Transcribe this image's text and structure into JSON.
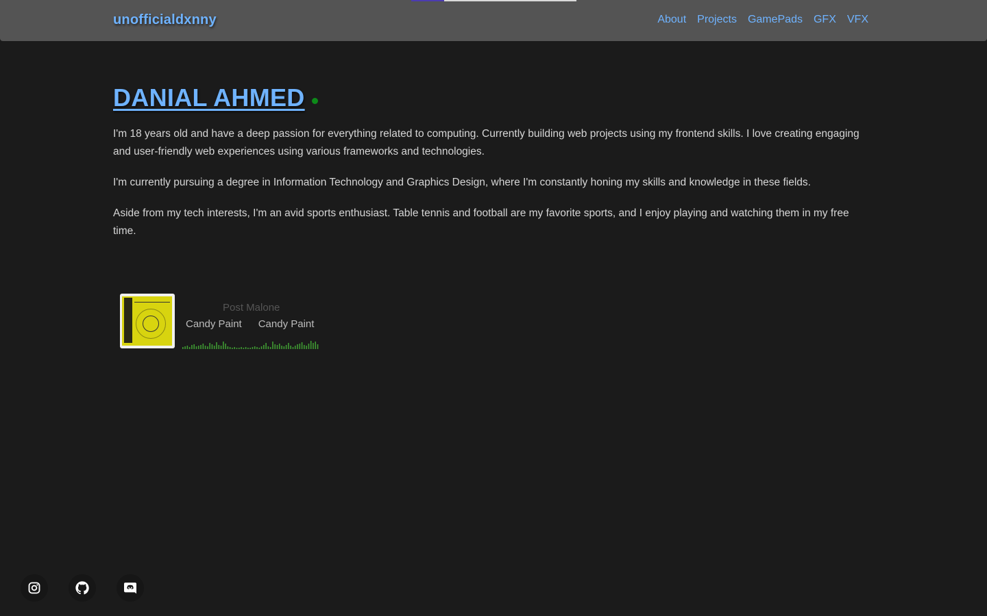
{
  "header": {
    "brand": "unofficialdxnny",
    "nav": [
      "About",
      "Projects",
      "GamePads",
      "GFX",
      "VFX"
    ],
    "scroll_progress": 0.2
  },
  "profile": {
    "name": "DANIAL AHMED",
    "status": "online",
    "status_color": "#0d8a19",
    "paragraphs": [
      "I'm 18 years old and have a deep passion for everything related to computing. Currently building web projects using my frontend skills. I love creating engaging and user-friendly web experiences using various frameworks and technologies.",
      "I'm currently pursuing a degree in Information Technology and Graphics Design, where I'm constantly honing my skills and knowledge in these fields.",
      "Aside from my tech interests, I'm an avid sports enthusiast. Table tennis and football are my favorite sports, and I enjoy playing and watching them in my free time."
    ]
  },
  "now_playing": {
    "artist": "Post Malone",
    "track": "Candy Paint",
    "album": "Candy Paint",
    "cover_icon": "album-cover",
    "wave_color": "#3f9b32"
  },
  "socials": [
    {
      "name": "instagram-icon"
    },
    {
      "name": "github-icon"
    },
    {
      "name": "discord-icon"
    }
  ],
  "colors": {
    "accent": "#6fb3ff",
    "background": "#1b1b1b",
    "header_bg": "#545454",
    "text": "#d6d6d6"
  }
}
